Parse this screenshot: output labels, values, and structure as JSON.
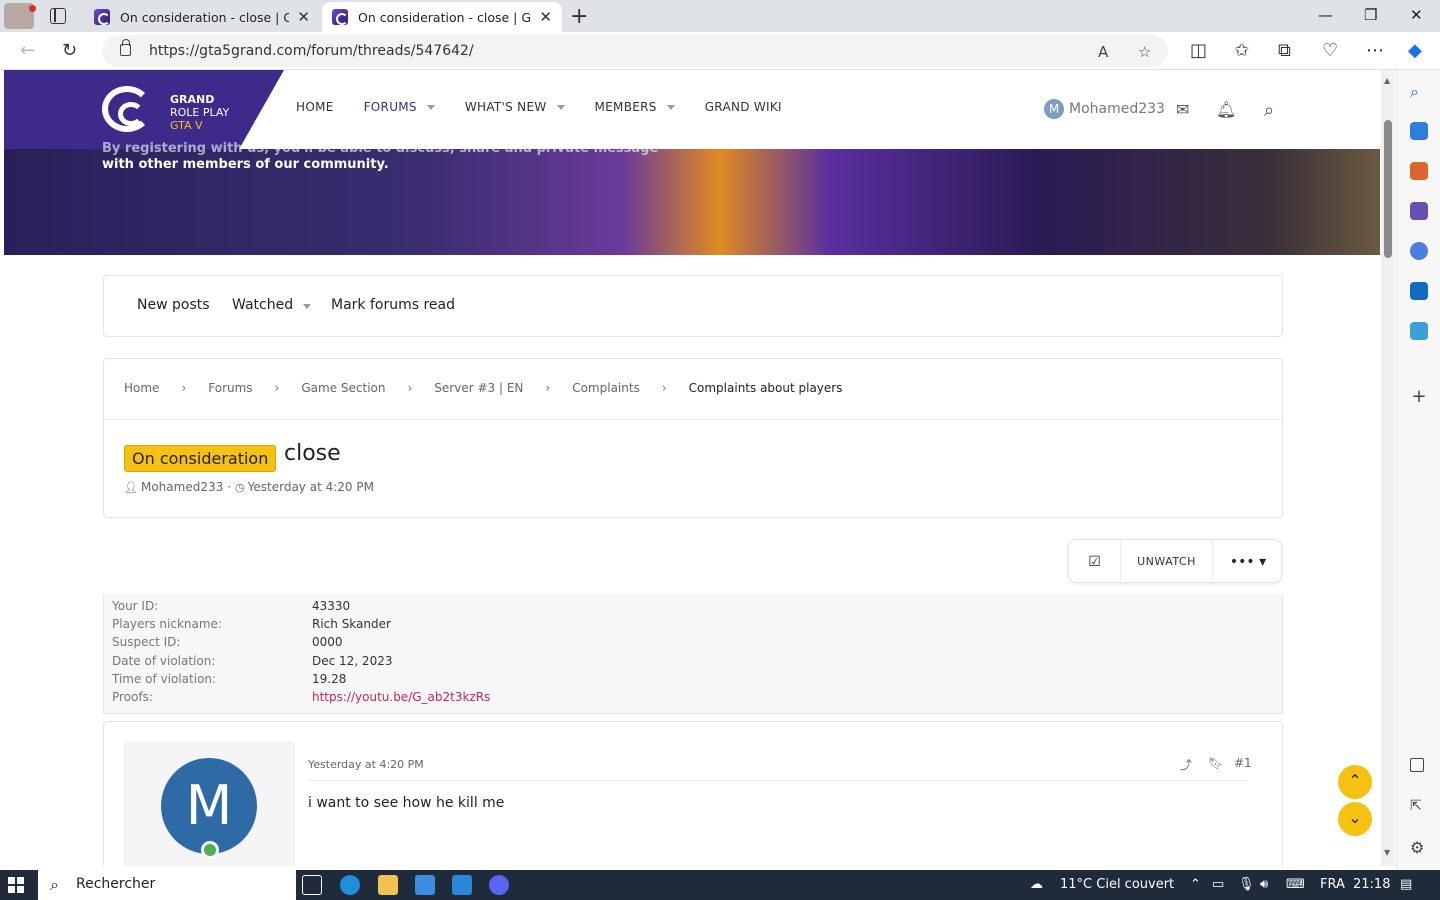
{
  "browser": {
    "tabs": [
      {
        "title": "On consideration - close | Grand"
      },
      {
        "title": "On consideration - close | Grand"
      }
    ],
    "url": "https://gta5grand.com/forum/threads/547642/"
  },
  "site": {
    "logo": {
      "line1": "GRAND",
      "line2": "ROLE PLAY",
      "line3": "GTA V"
    },
    "nav": [
      {
        "label": "HOME"
      },
      {
        "label": "FORUMS"
      },
      {
        "label": "WHAT'S NEW"
      },
      {
        "label": "MEMBERS"
      },
      {
        "label": "GRAND WIKI"
      }
    ],
    "username": "Mohamed233",
    "user_initial": "M",
    "banner_line1": "By registering with us, you'll be able to discuss, share and private message",
    "banner_line2": "with other members of our community."
  },
  "subnav": {
    "new_posts": "New posts",
    "watched": "Watched",
    "mark_read": "Mark forums read"
  },
  "breadcrumbs": [
    "Home",
    "Forums",
    "Game Section",
    "Server #3 | EN",
    "Complaints",
    "Complaints about players"
  ],
  "thread": {
    "prefix": "On consideration",
    "title": "close",
    "author": "Mohamed233",
    "date": "Yesterday at 4:20 PM"
  },
  "actions": {
    "unwatch": "UNWATCH"
  },
  "form_fields": [
    {
      "key": "Your ID:",
      "value": "43330"
    },
    {
      "key": "Players nickname:",
      "value": "Rich Skander"
    },
    {
      "key": "Suspect ID:",
      "value": "0000"
    },
    {
      "key": "Date of violation:",
      "value": "Dec 12, 2023"
    },
    {
      "key": "Time of violation:",
      "value": "19.28"
    },
    {
      "key": "Proofs:",
      "value": "https://youtu.be/G_ab2t3kzRs"
    }
  ],
  "post": {
    "avatar_letter": "M",
    "date": "Yesterday at 4:20 PM",
    "number": "#1",
    "body": "i want to see how he kill me",
    "author_partial": "Mohamed233"
  },
  "taskbar": {
    "search_placeholder": "Rechercher",
    "weather": "11°C  Ciel couvert",
    "lang": "FRA",
    "time": "21:18"
  }
}
